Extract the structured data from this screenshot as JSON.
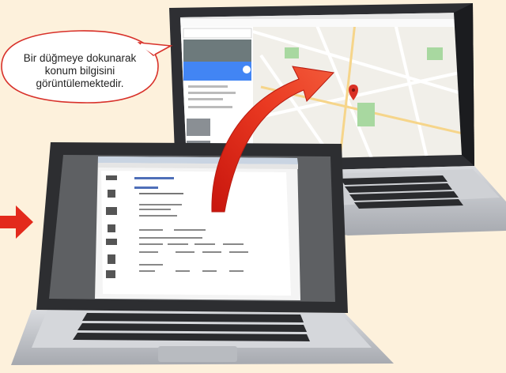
{
  "callout": {
    "line1": "Bir düğmeye dokunarak",
    "line2": "konum bilgisini",
    "line3": "görüntülemektedir."
  },
  "colors": {
    "background": "#fdf1dc",
    "arrow_red": "#e32a1c",
    "bubble_border": "#d8312a",
    "laptop_silver": "#c9cbcf",
    "laptop_dark": "#2d2e31",
    "maps_blue": "#4285f4",
    "map_green": "#a8d8a0"
  },
  "icons": [
    "right-arrow-icon",
    "curved-arrow-icon",
    "location-pin-icon",
    "speech-bubble-icon"
  ]
}
